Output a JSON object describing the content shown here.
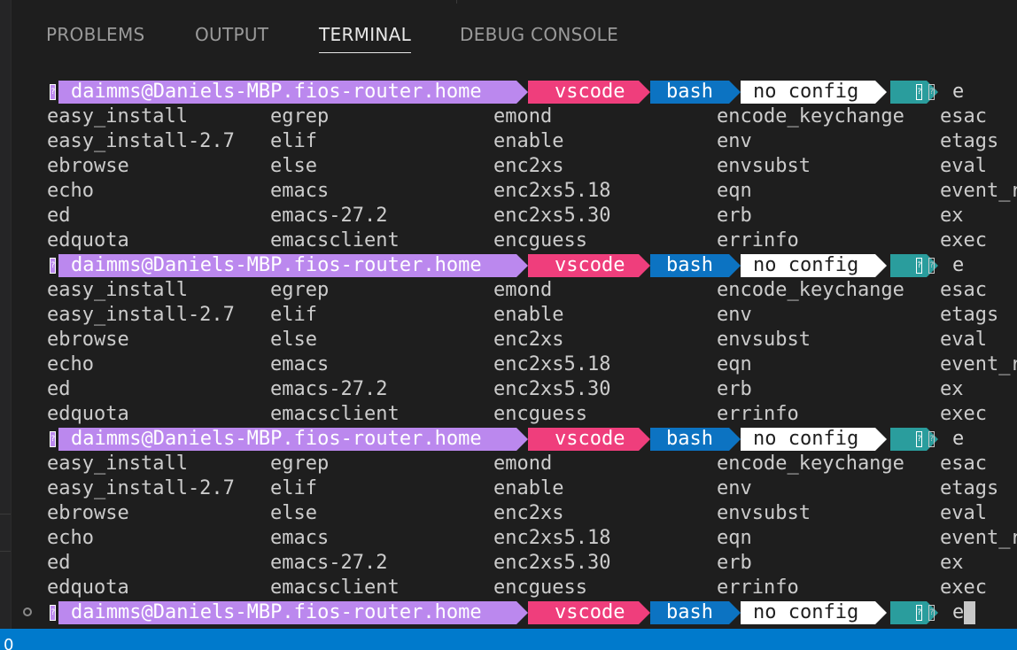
{
  "panel": {
    "tabs": [
      {
        "label": "PROBLEMS"
      },
      {
        "label": "OUTPUT"
      },
      {
        "label": "TERMINAL"
      },
      {
        "label": "DEBUG CONSOLE"
      }
    ],
    "active_tab": "TERMINAL"
  },
  "terminal": {
    "prompt": {
      "user_host": "daimms@Daniels-MBP.fios-router.home",
      "directory": "vscode",
      "shell": "bash",
      "config": "no config",
      "command": "e",
      "glyph": "?"
    },
    "completion_columns": [
      [
        "easy_install",
        "easy_install-2.7",
        "ebrowse",
        "echo",
        "ed",
        "edquota"
      ],
      [
        "egrep",
        "elif",
        "else",
        "emacs",
        "emacs-27.2",
        "emacsclient"
      ],
      [
        "emond",
        "enable",
        "enc2xs",
        "enc2xs5.18",
        "enc2xs5.30",
        "encguess"
      ],
      [
        "encode_keychange",
        "env",
        "envsubst",
        "eqn",
        "erb",
        "errinfo"
      ],
      [
        "esac",
        "etags",
        "eval",
        "event_r",
        "ex",
        "exec"
      ]
    ]
  },
  "colors": {
    "user_segment": "#bb88ee",
    "directory_segment": "#ef3e7c",
    "shell_segment": "#0c73c2",
    "config_segment": "#ffffff",
    "git_segment": "#2a9d9d",
    "status_bar": "#007acc"
  },
  "statusbar": {
    "text": "0"
  }
}
